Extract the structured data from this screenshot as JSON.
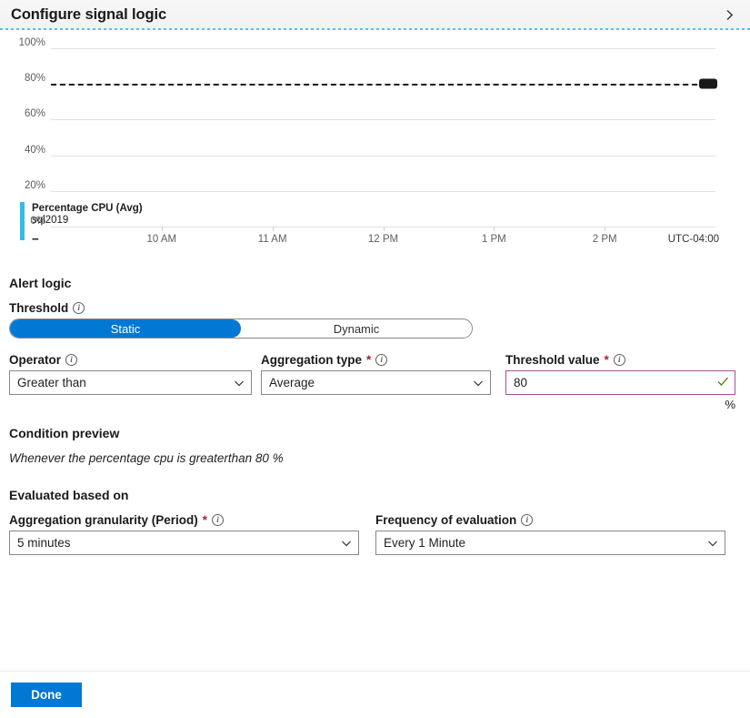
{
  "header": {
    "title": "Configure signal logic",
    "collapse_icon": "chevron-right-icon"
  },
  "chart_data": {
    "type": "line",
    "title": "",
    "xlabel": "",
    "ylabel": "",
    "ylim": [
      0,
      100
    ],
    "ytick_labels": [
      "100%",
      "80%",
      "60%",
      "40%",
      "20%",
      "0%"
    ],
    "ytick_values": [
      100,
      80,
      60,
      40,
      20,
      0
    ],
    "xtick_labels": [
      "10 AM",
      "11 AM",
      "12 PM",
      "1 PM",
      "2 PM"
    ],
    "timezone_label": "UTC-04:00",
    "grid": true,
    "legend_position": "below",
    "series": [
      {
        "name": "Percentage CPU (Avg)",
        "resource": "sql2019",
        "value": "--",
        "color": "#32bde6",
        "values": []
      }
    ],
    "annotations": [
      {
        "type": "threshold-line",
        "value": 80,
        "style": "dashed",
        "color": "#1b1a19",
        "handle": true
      }
    ]
  },
  "alert_logic": {
    "heading": "Alert logic",
    "threshold": {
      "label": "Threshold",
      "info_icon": "info-icon",
      "options": [
        "Static",
        "Dynamic"
      ],
      "selected": "Static"
    },
    "operator": {
      "label": "Operator",
      "info_icon": "info-icon",
      "value": "Greater than"
    },
    "aggregation_type": {
      "label": "Aggregation type",
      "required_marker": "*",
      "info_icon": "info-icon",
      "value": "Average"
    },
    "threshold_value": {
      "label": "Threshold value",
      "required_marker": "*",
      "info_icon": "info-icon",
      "value": "80",
      "validation_icon": "checkmark-icon",
      "unit": "%"
    }
  },
  "condition_preview": {
    "heading": "Condition preview",
    "text": "Whenever the percentage cpu is greaterthan 80 %"
  },
  "evaluated_based_on": {
    "heading": "Evaluated based on",
    "granularity": {
      "label": "Aggregation granularity (Period)",
      "required_marker": "*",
      "info_icon": "info-icon",
      "value": "5 minutes"
    },
    "frequency": {
      "label": "Frequency of evaluation",
      "info_icon": "info-icon",
      "value": "Every 1 Minute"
    }
  },
  "footer": {
    "done_label": "Done"
  },
  "colors": {
    "accent": "#0078d4",
    "series": "#32bde6",
    "required": "#a4262c",
    "valid": "#498205",
    "focus_border": "#a4519b"
  }
}
